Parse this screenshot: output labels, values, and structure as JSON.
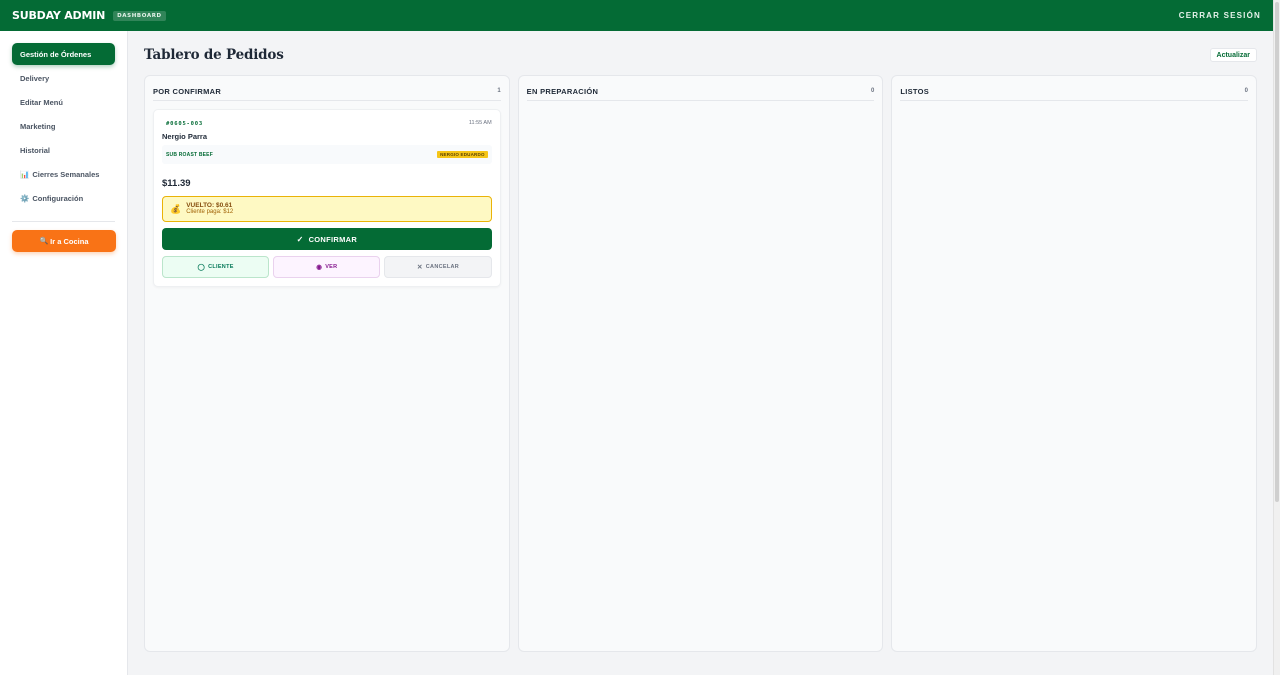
{
  "header": {
    "brand": "SUBDAY ADMIN",
    "badge": "DASHBOARD",
    "logout_label": "CERRAR SESIÓN"
  },
  "sidebar": {
    "items": [
      {
        "label": "Gestión de Órdenes",
        "active": true
      },
      {
        "label": "Delivery"
      },
      {
        "label": "Editar Menú"
      },
      {
        "label": "Marketing"
      },
      {
        "label": "Historial"
      },
      {
        "label": "Cierres Semanales",
        "icon": "bar-chart-icon"
      },
      {
        "label": "Configuración",
        "icon": "gear-icon"
      }
    ],
    "kitchen_button": {
      "label": "Ir a Cocina",
      "icon": "search-icon"
    }
  },
  "main": {
    "title": "Tablero de Pedidos",
    "refresh_label": "Actualizar",
    "columns": [
      {
        "title": "POR CONFIRMAR",
        "count": "1",
        "orders": [
          {
            "id": "#0605-003",
            "time": "11:55 AM",
            "customer": "Nergio Parra",
            "item_name": "SUB ROAST BEEF",
            "item_tag": "NERGIO EDUARDO",
            "total": "$11.39",
            "change_title": "VUELTO: $0.61",
            "change_sub": "Cliente paga: $12",
            "change_icon": "money-bag-icon",
            "confirm_label": "CONFIRMAR",
            "client_label": "CLIENTE",
            "view_label": "VER",
            "cancel_label": "CANCELAR"
          }
        ]
      },
      {
        "title": "EN PREPARACIÓN",
        "count": "0"
      },
      {
        "title": "LISTOS",
        "count": "0"
      }
    ]
  },
  "colors": {
    "brand_green": "#046b35",
    "kitchen_orange": "#f97316",
    "warning_yellow": "#fef9c3"
  }
}
